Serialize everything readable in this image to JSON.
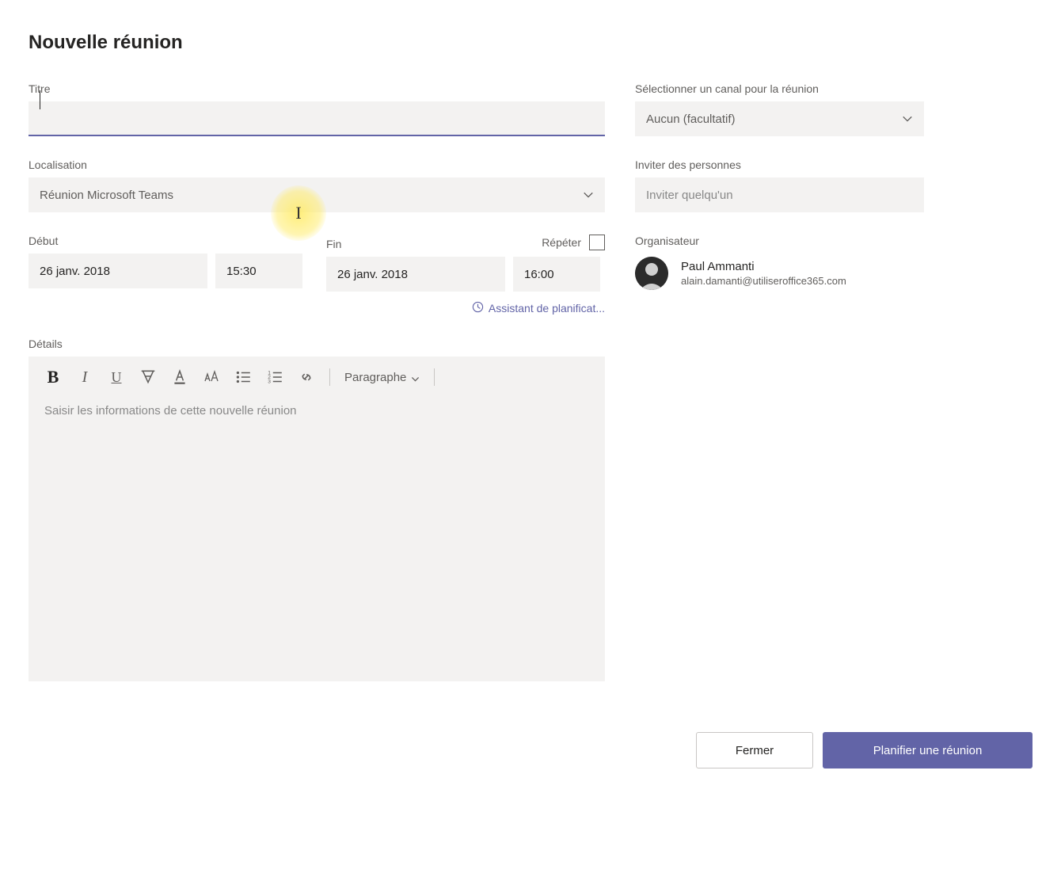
{
  "header": {
    "title": "Nouvelle réunion"
  },
  "fields": {
    "title_label": "Titre",
    "title_value": "",
    "location_label": "Localisation",
    "location_value": "Réunion Microsoft Teams",
    "start_label": "Début",
    "start_date": "26 janv. 2018",
    "start_time": "15:30",
    "end_label": "Fin",
    "end_date": "26 janv. 2018",
    "end_time": "16:00",
    "repeat_label": "Répéter",
    "assistant_link": "Assistant de planificat...",
    "details_label": "Détails",
    "details_placeholder": "Saisir les informations de cette nouvelle réunion",
    "paragraph_dropdown": "Paragraphe"
  },
  "sidebar": {
    "channel_label": "Sélectionner un canal pour la réunion",
    "channel_value": "Aucun (facultatif)",
    "invite_label": "Inviter des personnes",
    "invite_placeholder": "Inviter quelqu'un",
    "organizer_label": "Organisateur",
    "organizer_name": "Paul Ammanti",
    "organizer_email": "alain.damanti@utiliseroffice365.com"
  },
  "footer": {
    "close_label": "Fermer",
    "schedule_label": "Planifier une réunion"
  }
}
